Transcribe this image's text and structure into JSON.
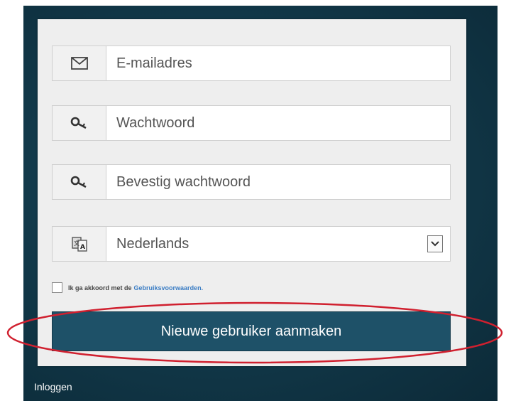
{
  "form": {
    "email_placeholder": "E-mailadres",
    "password_placeholder": "Wachtwoord",
    "confirm_placeholder": "Bevestig wachtwoord",
    "language_value": "Nederlands",
    "terms_text": "Ik ga akkoord met de",
    "terms_link": "Gebruiksvoorwaarden.",
    "create_button": "Nieuwe gebruiker aanmaken",
    "login_link": "Inloggen"
  },
  "icons": {
    "email": "envelope-icon",
    "password": "key-icon",
    "confirm": "key-icon",
    "language": "translate-icon",
    "dropdown": "chevron-down-icon"
  },
  "colors": {
    "background": "#123a4b",
    "panel": "#eeeeee",
    "button": "#1e5168",
    "link": "#3b7dc4",
    "highlight": "#d0202f"
  }
}
